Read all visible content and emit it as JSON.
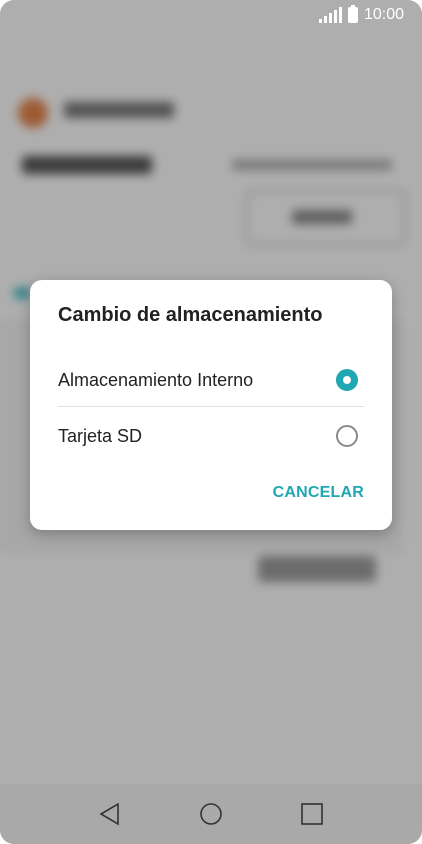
{
  "status_bar": {
    "time": "10:00"
  },
  "dialog": {
    "title": "Cambio de almacenamiento",
    "options": [
      {
        "label": "Almacenamiento Interno",
        "selected": true
      },
      {
        "label": "Tarjeta SD",
        "selected": false
      }
    ],
    "cancel_label": "CANCELAR"
  },
  "colors": {
    "accent": "#20a7b4",
    "nav_bar": "#a9a9a9",
    "scrim": "rgba(0,0,0,0.30)"
  },
  "nav_bar": {
    "icons": [
      "back-icon",
      "home-icon",
      "recents-icon"
    ]
  }
}
